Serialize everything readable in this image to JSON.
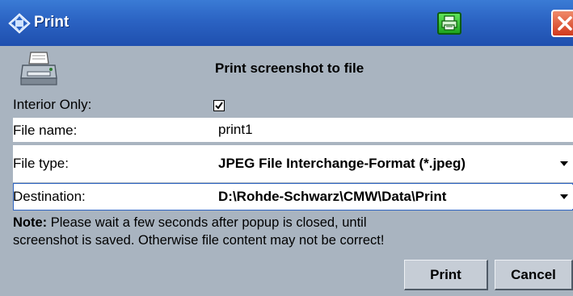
{
  "window": {
    "title": "Print",
    "header_title": "Print screenshot to file"
  },
  "form": {
    "interior_only_label": "Interior Only:",
    "interior_only_checked": true,
    "file_name_label": "File name:",
    "file_name_value": "print1",
    "file_type_label": "File type:",
    "file_type_value": "JPEG File Interchange-Format (*.jpeg)",
    "destination_label": "Destination:",
    "destination_value": "D:\\Rohde-Schwarz\\CMW\\Data\\Print"
  },
  "note": {
    "prefix": "Note:",
    "line1": " Please wait a few seconds after popup is closed, until",
    "line2": "screenshot is saved. Otherwise file content may not be correct!"
  },
  "buttons": {
    "print": "Print",
    "cancel": "Cancel"
  },
  "icons": {
    "title_icon": "diamond-arrows-icon",
    "title_print": "printer-icon",
    "title_close": "close-icon",
    "header_printer": "printer-icon",
    "checkbox": "checkmark-icon",
    "dropdown": "chevron-down-icon"
  },
  "colors": {
    "titlebar": "#2b63c3",
    "dialog_bg": "#a9b4c0",
    "print_button": "#1fa51d",
    "close_button": "#d2391d"
  }
}
